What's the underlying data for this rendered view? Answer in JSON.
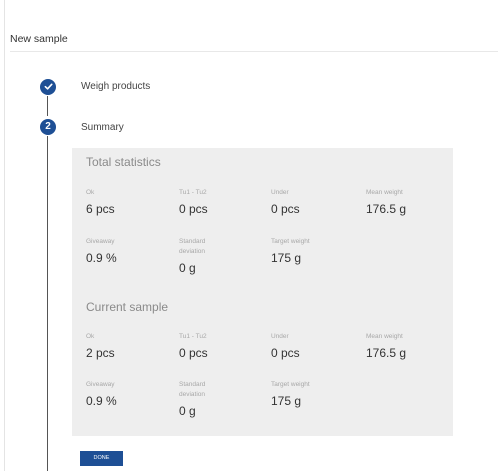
{
  "dialog": {
    "title": "New sample"
  },
  "steps": [
    {
      "label": "Weigh products",
      "status": "completed",
      "icon": "check-icon"
    },
    {
      "label": "Summary",
      "status": "active",
      "number": "2"
    }
  ],
  "total_statistics": {
    "title": "Total statistics",
    "ok": {
      "label": "Ok",
      "value": "6 pcs"
    },
    "tu1_tu2": {
      "label": "Tu1 - Tu2",
      "value": "0 pcs"
    },
    "under": {
      "label": "Under",
      "value": "0 pcs"
    },
    "mean_weight": {
      "label": "Mean weight",
      "value": "176.5 g"
    },
    "giveaway": {
      "label": "Giveaway",
      "value": "0.9 %"
    },
    "std_dev": {
      "label_1": "Standard",
      "label_2": "deviation",
      "value": "0 g"
    },
    "target_weight": {
      "label": "Target weight",
      "value": "175 g"
    }
  },
  "current_sample": {
    "title": "Current sample",
    "ok": {
      "label": "Ok",
      "value": "2 pcs"
    },
    "tu1_tu2": {
      "label": "Tu1 - Tu2",
      "value": "0 pcs"
    },
    "under": {
      "label": "Under",
      "value": "0 pcs"
    },
    "mean_weight": {
      "label": "Mean weight",
      "value": "176.5 g"
    },
    "giveaway": {
      "label": "Giveaway",
      "value": "0.9 %"
    },
    "std_dev": {
      "label_1": "Standard",
      "label_2": "deviation",
      "value": "0 g"
    },
    "target_weight": {
      "label": "Target weight",
      "value": "175 g"
    }
  },
  "actions": {
    "done_label": "DONE"
  },
  "colors": {
    "accent": "#1e4f95",
    "panel_background": "#eeeeee"
  }
}
